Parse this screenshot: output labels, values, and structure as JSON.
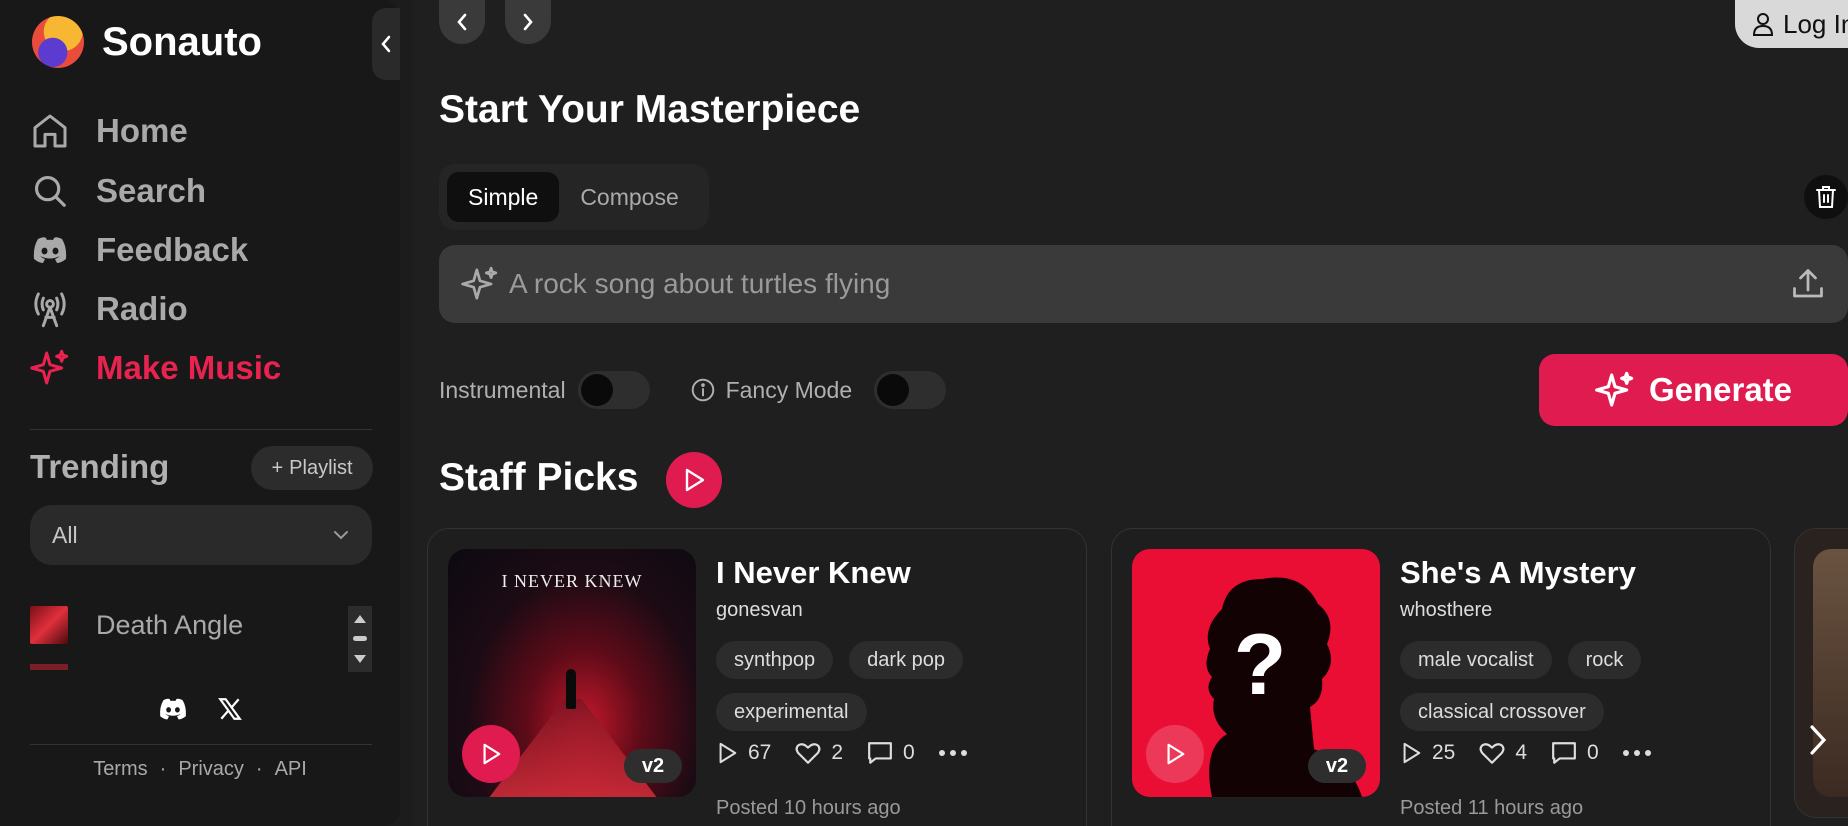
{
  "brand": {
    "name": "Sonauto"
  },
  "nav": [
    {
      "label": "Home",
      "icon": "home-icon"
    },
    {
      "label": "Search",
      "icon": "search-icon"
    },
    {
      "label": "Feedback",
      "icon": "discord-icon"
    },
    {
      "label": "Radio",
      "icon": "radio-icon"
    },
    {
      "label": "Make Music",
      "icon": "sparkles-icon",
      "active": true
    }
  ],
  "trending": {
    "title": "Trending",
    "playlist_label": "Playlist",
    "filter_value": "All",
    "items": [
      {
        "title": "Death Angle"
      }
    ]
  },
  "footer": {
    "terms": "Terms",
    "privacy": "Privacy",
    "api": "API",
    "separator": "·"
  },
  "header": {
    "login_label": "Log In"
  },
  "create": {
    "title": "Start Your Masterpiece",
    "tabs": [
      {
        "label": "Simple",
        "active": true
      },
      {
        "label": "Compose"
      }
    ],
    "prompt_placeholder": "A rock song about turtles flying",
    "instrumental_label": "Instrumental",
    "fancy_label": "Fancy Mode",
    "generate_label": "Generate"
  },
  "staff_picks": {
    "title": "Staff Picks",
    "songs": [
      {
        "title": "I Never Knew",
        "author": "gonesvan",
        "cover_text": "I NEVER KNEW",
        "tags": [
          "synthpop",
          "dark pop",
          "experimental"
        ],
        "plays": "67",
        "likes": "2",
        "comments": "0",
        "version": "v2",
        "posted": "Posted 10 hours ago"
      },
      {
        "title": "She's A Mystery",
        "author": "whosthere",
        "tags": [
          "male vocalist",
          "rock",
          "classical crossover"
        ],
        "plays": "25",
        "likes": "4",
        "comments": "0",
        "version": "v2",
        "posted": "Posted 11 hours ago"
      }
    ]
  },
  "colors": {
    "accent": "#e01b4f",
    "sidebar_bg": "#181818",
    "main_bg": "#1f1f1f"
  }
}
